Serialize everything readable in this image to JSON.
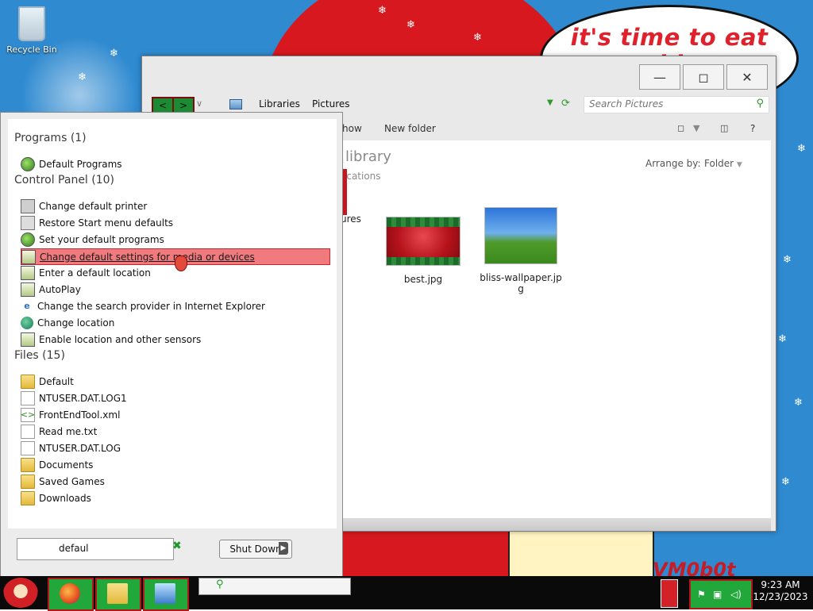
{
  "desktop": {
    "speech_text": "it's time to eat shit",
    "watermark_text": "VM0b0t",
    "icons": [
      {
        "label": "Recycle Bin",
        "icon": "recycle-bin-icon"
      }
    ]
  },
  "explorer": {
    "window_buttons": {
      "minimize": "—",
      "maximize": "◻",
      "close": "✕"
    },
    "nav": {
      "back": "<",
      "forward": ">"
    },
    "breadcrumb": [
      "Libraries",
      "Pictures"
    ],
    "search_placeholder": "Search Pictures",
    "command_bar": {
      "slideshow_partial": "how",
      "new_folder": "New folder",
      "help": "?"
    },
    "library_title_partial": "library",
    "library_subtitle_partial": "ocations",
    "arrange_by_label": "Arrange by:",
    "arrange_by_value": "Folder",
    "files": [
      {
        "name_partial": "ures",
        "thumbnail": "red-christmas-partial"
      },
      {
        "name": "best.jpg",
        "thumbnail": "christmas-banner"
      },
      {
        "name": "bliss-wallpaper.jp\ng",
        "thumbnail": "bliss"
      }
    ]
  },
  "start_menu": {
    "groups": [
      {
        "title": "Programs (1)",
        "items": [
          {
            "label": "Default Programs",
            "icon": "default-programs-icon"
          }
        ]
      },
      {
        "title": "Control Panel (10)",
        "items": [
          {
            "label": "Change default printer",
            "icon": "printer-icon"
          },
          {
            "label": "Restore Start menu defaults",
            "icon": "taskbar-icon"
          },
          {
            "label": "Set your default programs",
            "icon": "default-programs-icon"
          },
          {
            "label": "Change default settings for media or devices",
            "icon": "autoplay-icon",
            "selected": true
          },
          {
            "label": "Enter a default location",
            "icon": "location-icon"
          },
          {
            "label": "AutoPlay",
            "icon": "autoplay-icon"
          },
          {
            "label": "Change the search provider in Internet Explorer",
            "icon": "internet-explorer-icon"
          },
          {
            "label": "Change location",
            "icon": "globe-icon"
          },
          {
            "label": "Enable location and other sensors",
            "icon": "location-icon"
          }
        ]
      },
      {
        "title": "Files (15)",
        "items": [
          {
            "label": "Default",
            "icon": "folder-icon"
          },
          {
            "label": "NTUSER.DAT.LOG1",
            "icon": "file-icon"
          },
          {
            "label": "FrontEndTool.xml",
            "icon": "xml-file-icon"
          },
          {
            "label": "Read me.txt",
            "icon": "text-file-icon"
          },
          {
            "label": "NTUSER.DAT.LOG",
            "icon": "file-icon"
          },
          {
            "label": "Documents",
            "icon": "folder-icon"
          },
          {
            "label": "Saved Games",
            "icon": "folder-icon"
          },
          {
            "label": "Downloads",
            "icon": "folder-icon"
          }
        ]
      }
    ],
    "search_value": "defaul",
    "clear_icon": "✖",
    "shutdown_label": "Shut Down"
  },
  "taskbar": {
    "pinned": [
      "firefox-icon",
      "file-explorer-icon",
      "control-panel-icon"
    ],
    "clock_time": "9:23 AM",
    "clock_date": "12/23/2023"
  }
}
